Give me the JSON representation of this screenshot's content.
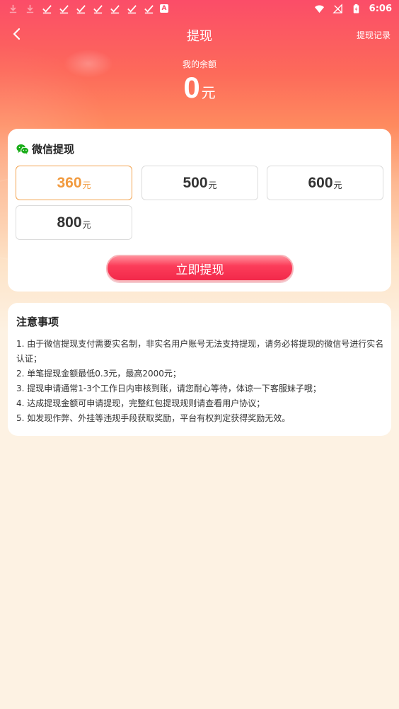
{
  "status_bar": {
    "time": "6:06",
    "left_icons": [
      "download-icon",
      "download-icon",
      "check-icon",
      "check-icon",
      "check-icon",
      "check-icon",
      "check-icon",
      "check-icon",
      "check-icon",
      "a-app-icon"
    ],
    "a_badge": "A",
    "right_icons": [
      "wifi-icon",
      "no-signal-icon",
      "battery-charging-icon"
    ]
  },
  "nav": {
    "title": "提现",
    "right_link": "提现记录"
  },
  "balance": {
    "label": "我的余额",
    "amount": "0",
    "unit": "元"
  },
  "withdraw": {
    "method_title": "微信提现",
    "options": [
      {
        "amount": "360",
        "unit": "元",
        "selected": true
      },
      {
        "amount": "500",
        "unit": "元",
        "selected": false
      },
      {
        "amount": "600",
        "unit": "元",
        "selected": false
      },
      {
        "amount": "800",
        "unit": "元",
        "selected": false
      }
    ],
    "submit_label": "立即提现"
  },
  "notice": {
    "title": "注意事项",
    "items": [
      "1. 由于微信提现支付需要实名制，非实名用户账号无法支持提现，请务必将提现的微信号进行实名认证；",
      "2. 单笔提现金额最低0.3元，最高2000元；",
      "3. 提现申请通常1-3个工作日内审核到账，请您耐心等待，体谅一下客服妹子哦；",
      "4. 达成提现金额可申请提现，完整红包提现规则请查看用户协议；",
      "5. 如发现作弊、外挂等违规手段获取奖励，平台有权判定获得奖励无效。"
    ]
  },
  "colors": {
    "header_red": "#fb4d68",
    "selected_orange": "#f19a3e",
    "wechat_green": "#1aad19",
    "page_bg": "#fdf2e3"
  }
}
